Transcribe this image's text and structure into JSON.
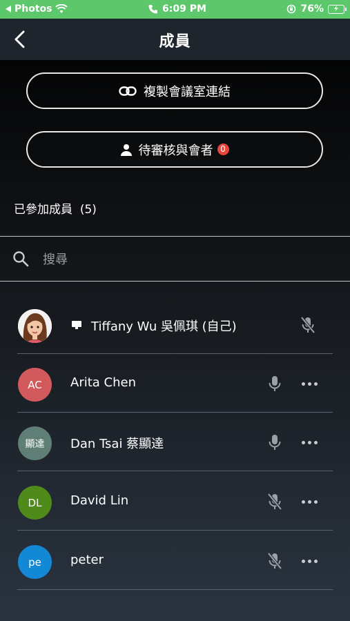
{
  "status_bar": {
    "back_app": "Photos",
    "time": "6:09 PM",
    "battery": "76%"
  },
  "nav": {
    "title": "成員"
  },
  "actions": {
    "copy_link": "複製會議室連結",
    "pending": "待審核與會者",
    "pending_count": "0"
  },
  "section": {
    "joined_label": "已參加成員",
    "joined_count": "(5)"
  },
  "search": {
    "placeholder": "搜尋"
  },
  "members": [
    {
      "name": "Tiffany Wu 吳佩琪 (自己)",
      "initials": "",
      "avatar_color": "#ffffff",
      "mic": "muted",
      "sharing": true
    },
    {
      "name": "Arita Chen",
      "initials": "AC",
      "avatar_color": "#d25a5c",
      "mic": "on"
    },
    {
      "name": "Dan Tsai 蔡顯達",
      "initials": "顯達",
      "avatar_color": "#5f7f76",
      "mic": "on"
    },
    {
      "name": "David Lin",
      "initials": "DL",
      "avatar_color": "#4f8a1b",
      "mic": "muted"
    },
    {
      "name": "peter",
      "initials": "pe",
      "avatar_color": "#1389d6",
      "mic": "muted"
    }
  ],
  "icons": {
    "back": "chevron-left-icon",
    "link": "link-icon",
    "person": "person-icon",
    "search": "search-icon",
    "mic_on": "mic-icon",
    "mic_muted": "mic-off-icon",
    "more": "more-icon",
    "screen": "screen-share-icon"
  }
}
